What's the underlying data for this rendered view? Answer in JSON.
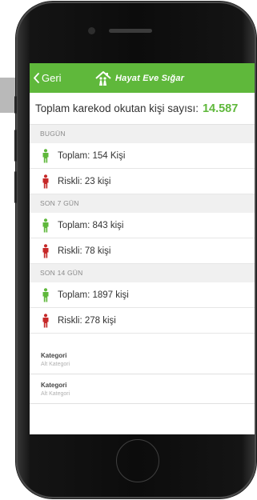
{
  "colors": {
    "accent": "#5fb83b",
    "safe_icon": "#5fb83b",
    "risk_icon": "#c62828"
  },
  "navbar": {
    "back_label": "Geri",
    "title": "Hayat Eve Sığar",
    "back_icon": "chevron-left-icon",
    "logo_icon": "house-with-people-logo"
  },
  "summary": {
    "label": "Toplam karekod okutan kişi sayısı:",
    "value": "14.587"
  },
  "sections": [
    {
      "header": "BUGÜN",
      "total": "Toplam: 154 Kişi",
      "risky": "Riskli: 23 kişi"
    },
    {
      "header": "SON 7 GÜN",
      "total": "Toplam: 843 kişi",
      "risky": "Riskli: 78 kişi"
    },
    {
      "header": "SON 14 GÜN",
      "total": "Toplam: 1897 kişi",
      "risky": "Riskli: 278 kişi"
    }
  ],
  "fields": [
    {
      "label": "Kategori",
      "sub": "Alt Kategori"
    },
    {
      "label": "Kategori",
      "sub": "Alt Kategori"
    }
  ]
}
